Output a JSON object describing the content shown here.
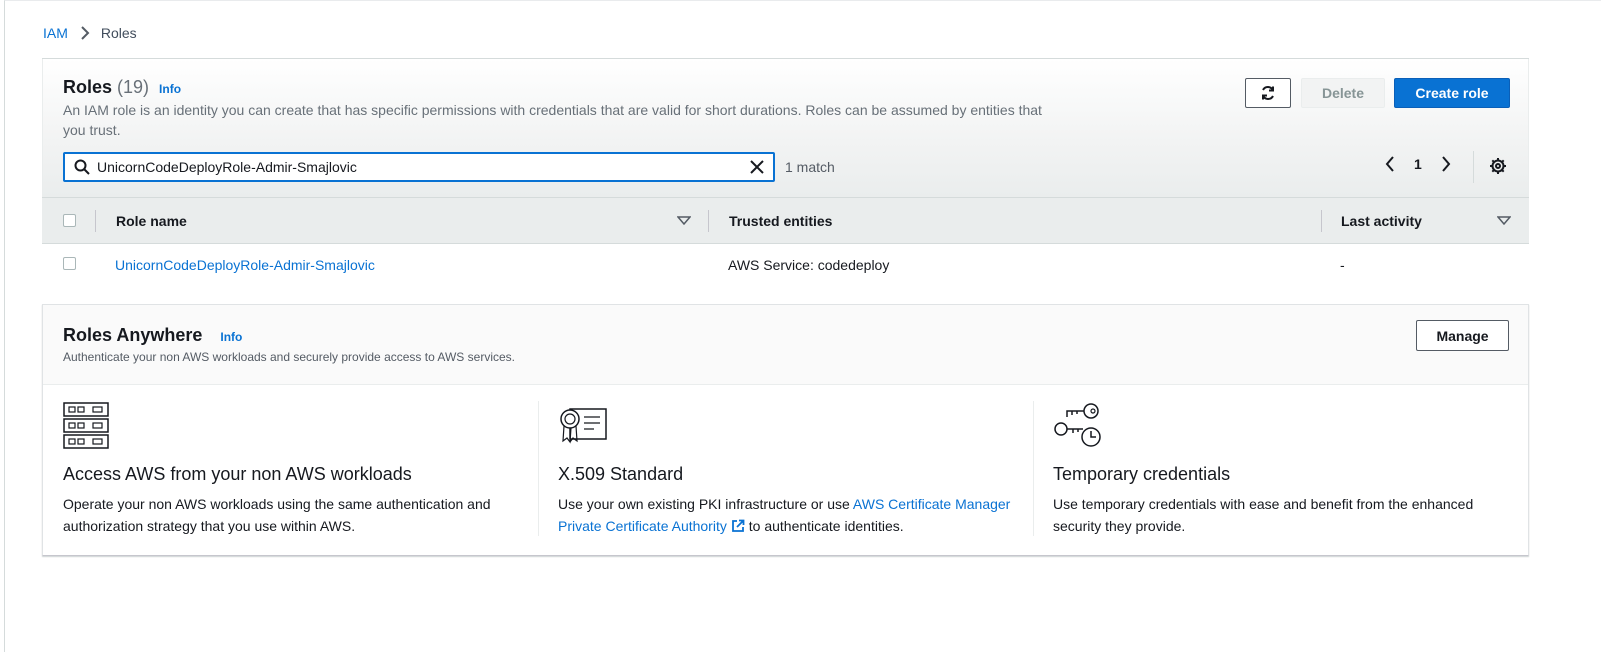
{
  "breadcrumb": {
    "root": "IAM",
    "current": "Roles"
  },
  "roles": {
    "title": "Roles",
    "count": "(19)",
    "info": "Info",
    "description": "An IAM role is an identity you can create that has specific permissions with credentials that are valid for short durations. Roles can be assumed by entities that you trust.",
    "buttons": {
      "refresh_icon": "refresh-icon",
      "delete": "Delete",
      "create": "Create role"
    },
    "search": {
      "value": "UnicornCodeDeployRole-Admir-Smajlovic",
      "placeholder": "Search"
    },
    "match_text": "1 match",
    "pagination": {
      "page": "1"
    },
    "table": {
      "columns": [
        "Role name",
        "Trusted entities",
        "Last activity"
      ],
      "rows": [
        {
          "role_name": "UnicornCodeDeployRole-Admir-Smajlovic",
          "trusted_entities": "AWS Service: codedeploy",
          "last_activity": "-"
        }
      ]
    }
  },
  "roles_anywhere": {
    "title": "Roles Anywhere",
    "info": "Info",
    "description": "Authenticate your non AWS workloads and securely provide access to AWS services.",
    "manage": "Manage",
    "features": [
      {
        "icon": "server-rack-icon",
        "title": "Access AWS from your non AWS workloads",
        "text": "Operate your non AWS workloads using the same authentication and authorization strategy that you use within AWS."
      },
      {
        "icon": "certificate-icon",
        "title": "X.509 Standard",
        "text_before": "Use your own existing PKI infrastructure or use ",
        "link": "AWS Certificate Manager Private Certificate Authority",
        "text_after": " to authenticate identities."
      },
      {
        "icon": "keys-clock-icon",
        "title": "Temporary credentials",
        "text": "Use temporary credentials with ease and benefit from the enhanced security they provide."
      }
    ]
  },
  "colors": {
    "link": "#0972d3",
    "primary_button": "#0972d3",
    "header_bg": "#eaeded",
    "text": "#16191f"
  }
}
